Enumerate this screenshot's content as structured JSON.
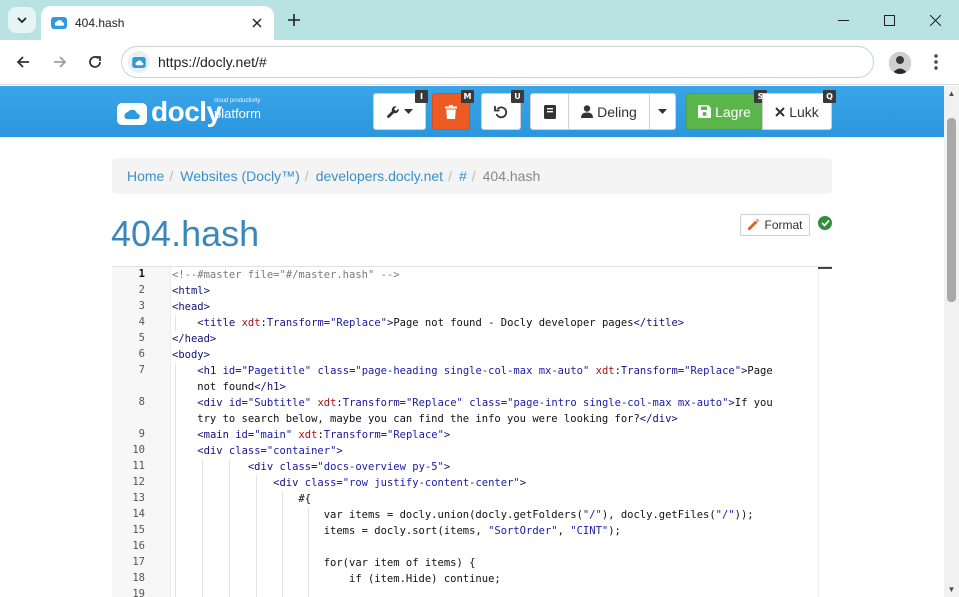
{
  "browser": {
    "tab_title": "404.hash",
    "url": "https://docly.net/#"
  },
  "app": {
    "logo_word": "docly",
    "logo_sub": "cloud productivity",
    "logo_platform": "platform",
    "buttons": {
      "tools_kbd": "I",
      "delete_kbd": "M",
      "undo_kbd": "U",
      "share_label": "Deling",
      "save_label": "Lagre",
      "save_kbd": "S",
      "close_label": "Lukk",
      "close_kbd": "Q"
    }
  },
  "breadcrumb": {
    "items": [
      "Home",
      "Websites (Docly™)",
      "developers.docly.net",
      "#"
    ],
    "active": "404.hash"
  },
  "page_title": "404.hash",
  "format_label": "Format",
  "editor": {
    "line_numbers": [
      "1",
      "2",
      "3",
      "4",
      "5",
      "6",
      "7",
      "",
      "8",
      "",
      "9",
      "10",
      "11",
      "12",
      "13",
      "14",
      "15",
      "16",
      "17",
      "18",
      "19"
    ]
  }
}
